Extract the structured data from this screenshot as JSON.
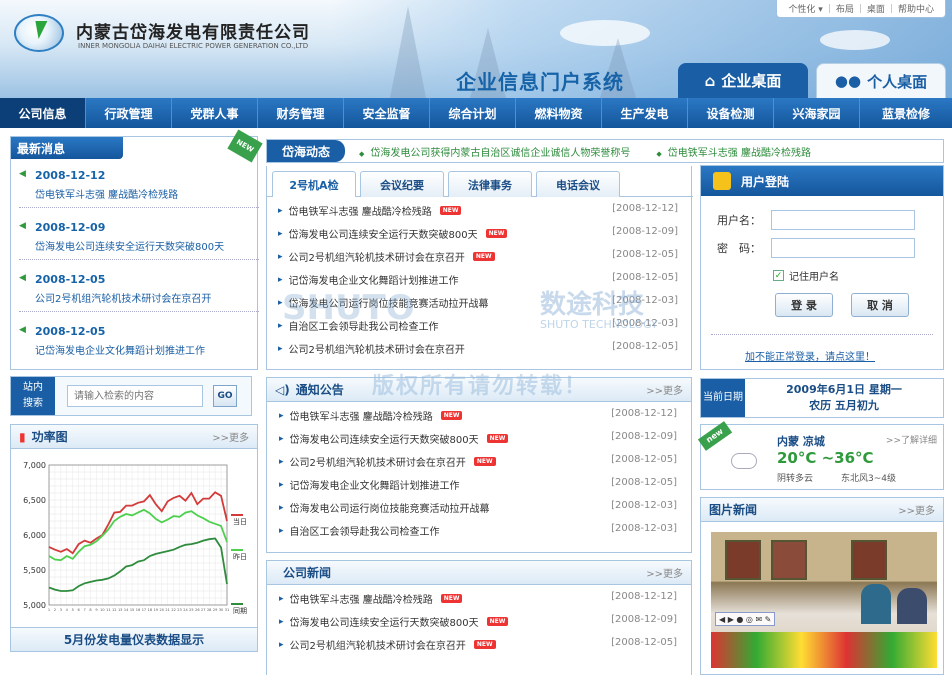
{
  "header": {
    "company_cn": "内蒙古岱海发电有限责任公司",
    "company_en": "INNER MONGOLIA DAIHAI ELECTRIC POWER GENERATION CO.,LTD",
    "portal_title": "企业信息门户系统",
    "toplinks": [
      "个性化 ▾",
      "布局",
      "桌面",
      "帮助中心"
    ],
    "tab_enterprise": "企业桌面",
    "tab_personal": "个人桌面"
  },
  "nav": [
    "公司信息",
    "行政管理",
    "党群人事",
    "财务管理",
    "安全监督",
    "综合计划",
    "燃料物资",
    "生产发电",
    "设备检测",
    "兴海家园",
    "蓝景检修"
  ],
  "latest_news": {
    "title": "最新消息",
    "badge": "NEW",
    "items": [
      {
        "date": "2008-12-12",
        "title": "岱电铁军斗志强 鏖战酷冷检残路"
      },
      {
        "date": "2008-12-09",
        "title": "岱海发电公司连续安全运行天数突破800天"
      },
      {
        "date": "2008-12-05",
        "title": "公司2号机组汽轮机技术研讨会在京召开"
      },
      {
        "date": "2008-12-05",
        "title": "记岱海发电企业文化舞蹈计划推进工作"
      }
    ]
  },
  "search": {
    "label_1": "站内",
    "label_2": "搜索",
    "placeholder": "请输入检索的内容",
    "go": "GO"
  },
  "power_chart": {
    "title": "功率图",
    "more": ">>更多",
    "caption": "5月份发电量仪表数据显示"
  },
  "chart_data": {
    "type": "line",
    "title": "",
    "ylim": [
      5000,
      7000
    ],
    "yticks": [
      "7,000",
      "6,500",
      "6,000",
      "5,500",
      "5,000"
    ],
    "x": [
      1,
      2,
      3,
      4,
      5,
      6,
      7,
      8,
      9,
      10,
      11,
      12,
      13,
      14,
      15,
      16,
      17,
      18,
      19,
      20,
      21,
      22,
      23,
      24,
      25,
      26,
      27,
      28,
      29,
      30,
      31
    ],
    "series": [
      {
        "name": "当日",
        "color": "#d43a3a",
        "values": [
          5830,
          5790,
          5760,
          5800,
          5740,
          5870,
          5920,
          5890,
          5950,
          6000,
          6150,
          6320,
          6330,
          6420,
          6420,
          6460,
          6480,
          6570,
          6440,
          6340,
          6480,
          6530,
          6560,
          6490,
          6600,
          6440,
          6520,
          6520,
          6610,
          6560,
          6200
        ]
      },
      {
        "name": "昨日",
        "color": "#4ecf4e",
        "values": [
          5700,
          5650,
          5640,
          5700,
          5660,
          5760,
          5840,
          5860,
          5910,
          5990,
          6080,
          6200,
          6260,
          6300,
          6280,
          6320,
          6360,
          6310,
          6230,
          6180,
          6220,
          6270,
          6260,
          6320,
          6340,
          6280,
          6240,
          6190,
          6160,
          6130,
          5900
        ]
      },
      {
        "name": "同期",
        "color": "#2e8c3c",
        "values": [
          5250,
          5220,
          5200,
          5200,
          5210,
          5270,
          5310,
          5330,
          5350,
          5360,
          5380,
          5420,
          5480,
          5550,
          5570,
          5620,
          5640,
          5700,
          5730,
          5750,
          5770,
          5790,
          5830,
          5860,
          5870,
          5890,
          5920,
          5940,
          5950,
          5820,
          5300
        ]
      }
    ]
  },
  "marquee": {
    "title": "岱海动态",
    "items": [
      "岱海发电公司获得内蒙古自治区诚信企业诚信人物荣誉称号",
      "岱电铁军斗志强 鏖战酷冷检残路"
    ]
  },
  "tabs": [
    "2号机A检",
    "会议纪要",
    "法律事务",
    "电话会议"
  ],
  "tab_list": [
    {
      "title": "岱电铁军斗志强 鏖战酷冷检残路",
      "new": "NEW",
      "date": "[2008-12-12]"
    },
    {
      "title": "岱海发电公司连续安全运行天数突破800天",
      "new": "NEW",
      "date": "[2008-12-09]"
    },
    {
      "title": "公司2号机组汽轮机技术研讨会在京召开",
      "new": "NEW",
      "date": "[2008-12-05]"
    },
    {
      "title": "记岱海发电企业文化舞蹈计划推进工作",
      "date": "[2008-12-05]"
    },
    {
      "title": "岱海发电公司运行岗位技能竞赛活动拉开战幕",
      "date": "[2008-12-03]"
    },
    {
      "title": "自治区工会领导赴我公司检查工作",
      "date": "[2008-12-03]"
    },
    {
      "title": "公司2号机组汽轮机技术研讨会在京召开",
      "date": "[2008-12-05]"
    }
  ],
  "watermark": {
    "logo": "SHUTO",
    "cn": "数途科技",
    "en": "SHUTO TECHNOLOGY",
    "notice": "版权所有请勿转载！"
  },
  "notice": {
    "title": "通知公告",
    "more": ">>更多",
    "items": [
      {
        "title": "岱电铁军斗志强 鏖战酷冷检残路",
        "new": "NEW",
        "date": "[2008-12-12]"
      },
      {
        "title": "岱海发电公司连续安全运行天数突破800天",
        "new": "NEW",
        "date": "[2008-12-09]"
      },
      {
        "title": "公司2号机组汽轮机技术研讨会在京召开",
        "new": "NEW",
        "date": "[2008-12-05]"
      },
      {
        "title": "记岱海发电企业文化舞蹈计划推进工作",
        "date": "[2008-12-05]"
      },
      {
        "title": "岱海发电公司运行岗位技能竞赛活动拉开战幕",
        "date": "[2008-12-03]"
      },
      {
        "title": "自治区工会领导赴我公司检查工作",
        "date": "[2008-12-03]"
      }
    ]
  },
  "company_news": {
    "title": "公司新闻",
    "more": ">>更多",
    "items": [
      {
        "title": "岱电铁军斗志强 鏖战酷冷检残路",
        "new": "NEW",
        "date": "[2008-12-12]"
      },
      {
        "title": "岱海发电公司连续安全运行天数突破800天",
        "new": "NEW",
        "date": "[2008-12-09]"
      },
      {
        "title": "公司2号机组汽轮机技术研讨会在京召开",
        "new": "NEW",
        "date": "[2008-12-05]"
      }
    ]
  },
  "login": {
    "title": "用户登陆",
    "user_label": "用户名：",
    "pass_label": "密　码：",
    "remember": "记住用户名",
    "login_btn": "登 录",
    "cancel_btn": "取 消",
    "help": "加不能正常登录，请点这里！"
  },
  "date": {
    "label_1": "当前",
    "label_2": "日期",
    "line1": "2009年6月1日  星期一",
    "line2": "农历  五月初九"
  },
  "weather": {
    "badge": "new",
    "city": "内蒙  凉城",
    "more": ">>了解详细",
    "temp": "20°C ~36°C",
    "desc": "阴转多云",
    "wind": "东北风3~4级"
  },
  "photo_news": {
    "title": "图片新闻",
    "more": ">>更多"
  }
}
